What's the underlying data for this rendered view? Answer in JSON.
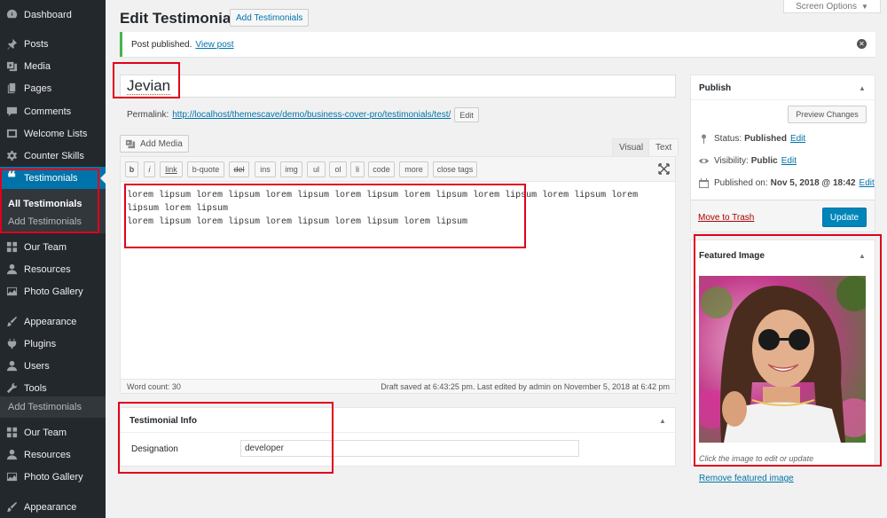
{
  "sidebar": {
    "items": [
      {
        "label": "Dashboard",
        "icon": "dashboard-icon"
      },
      {
        "label": "Posts",
        "icon": "pushpin-icon"
      },
      {
        "label": "Media",
        "icon": "media-icon"
      },
      {
        "label": "Pages",
        "icon": "pages-icon"
      },
      {
        "label": "Comments",
        "icon": "comment-icon"
      },
      {
        "label": "Welcome Lists",
        "icon": "welcome-icon"
      },
      {
        "label": "Counter Skills",
        "icon": "gear-icon"
      },
      {
        "label": "Testimonials",
        "icon": "quote-icon"
      },
      {
        "label": "Our Team",
        "icon": "grid-icon"
      },
      {
        "label": "Resources",
        "icon": "user-icon"
      },
      {
        "label": "Photo Gallery",
        "icon": "gallery-icon"
      },
      {
        "label": "Appearance",
        "icon": "paintbrush-icon"
      },
      {
        "label": "Plugins",
        "icon": "plugin-icon"
      },
      {
        "label": "Users",
        "icon": "user-icon"
      },
      {
        "label": "Tools",
        "icon": "wrench-icon"
      },
      {
        "label": "Our Team",
        "icon": "grid-icon"
      },
      {
        "label": "Resources",
        "icon": "user-icon"
      },
      {
        "label": "Photo Gallery",
        "icon": "gallery-icon"
      },
      {
        "label": "Appearance",
        "icon": "paintbrush-icon"
      }
    ],
    "submenu": {
      "current": "All Testimonials",
      "add": "Add Testimonials"
    },
    "lone_add": "Add Testimonials"
  },
  "header": {
    "title": "Edit Testimonial",
    "add_new": "Add Testimonials",
    "screen_options": "Screen Options"
  },
  "notice": {
    "text": "Post published.",
    "link": "View post"
  },
  "post": {
    "title": "Jevian",
    "permalink_label": "Permalink:",
    "permalink_url": "http://localhost/themescave/demo/business-cover-pro/testimonials/test/",
    "permalink_edit": "Edit"
  },
  "editor": {
    "add_media": "Add Media",
    "tabs": [
      "Visual",
      "Text"
    ],
    "active_tab": "Text",
    "quicktags": [
      "b",
      "i",
      "link",
      "b-quote",
      "del",
      "ins",
      "img",
      "ul",
      "ol",
      "li",
      "code",
      "more",
      "close tags"
    ],
    "content_line1": "lorem lipsum lorem lipsum lorem lipsum lorem lipsum lorem lipsum lorem lipsum lorem lipsum lorem lipsum lorem lipsum",
    "content_line2": "lorem lipsum lorem lipsum lorem lipsum lorem lipsum lorem lipsum",
    "word_count": "Word count: 30",
    "draft_saved": "Draft saved at 6:43:25 pm. Last edited by admin on November 5, 2018 at 6:42 pm"
  },
  "testimonial_info": {
    "title": "Testimonial Info",
    "designation_label": "Designation",
    "designation_value": "developer"
  },
  "publish": {
    "title": "Publish",
    "preview": "Preview Changes",
    "status_label": "Status:",
    "status_value": "Published",
    "visibility_label": "Visibility:",
    "visibility_value": "Public",
    "published_label": "Published on:",
    "published_value": "Nov 5, 2018 @ 18:42",
    "edit": "Edit",
    "trash": "Move to Trash",
    "update": "Update"
  },
  "featured": {
    "title": "Featured Image",
    "caption": "Click the image to edit or update",
    "remove": "Remove featured image"
  },
  "colors": {
    "sidebar": "#23282d",
    "accent": "#0073aa",
    "highlight": "#e0001b",
    "notice": "#46b450"
  }
}
